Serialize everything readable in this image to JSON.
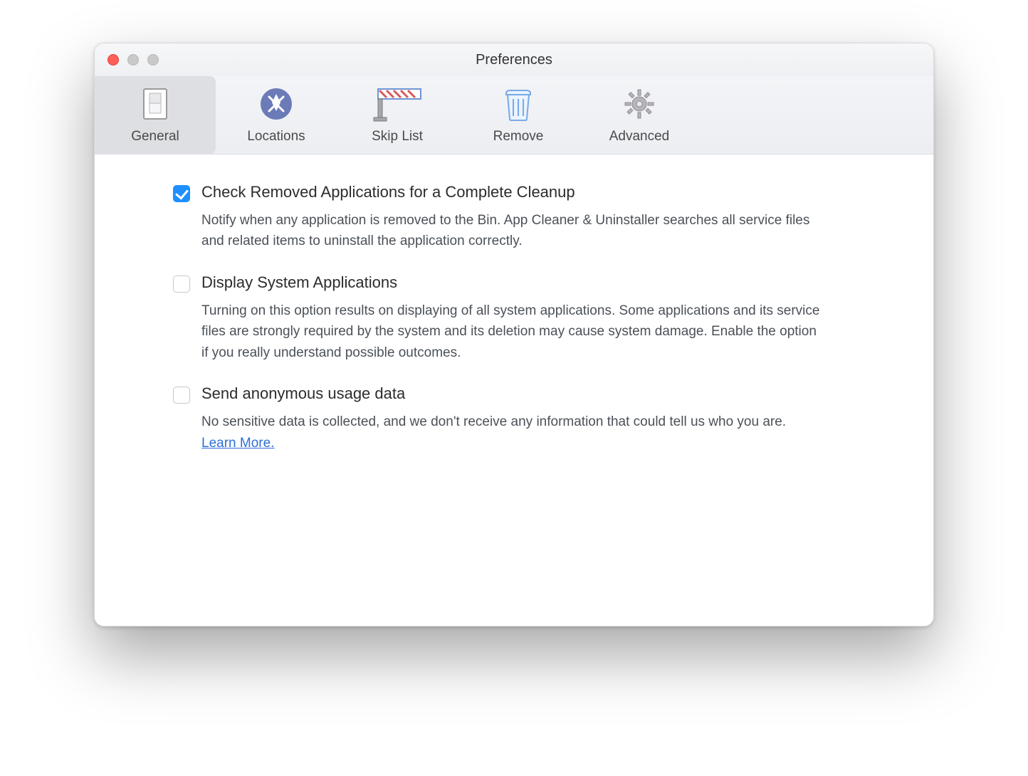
{
  "window": {
    "title": "Preferences"
  },
  "tabs": [
    {
      "label": "General",
      "selected": true
    },
    {
      "label": "Locations",
      "selected": false
    },
    {
      "label": "Skip List",
      "selected": false
    },
    {
      "label": "Remove",
      "selected": false
    },
    {
      "label": "Advanced",
      "selected": false
    }
  ],
  "options": [
    {
      "checked": true,
      "title": "Check Removed Applications for a Complete Cleanup",
      "desc": "Notify when any application is removed to the Bin. App Cleaner & Uninstaller searches all service files and related items to uninstall the application correctly."
    },
    {
      "checked": false,
      "title": "Display System Applications",
      "desc": "Turning on this option results on displaying of all system applications. Some applications and its service files are strongly required by the system and its deletion may cause system damage. Enable the option if you really understand possible outcomes."
    },
    {
      "checked": false,
      "title": "Send anonymous usage data",
      "desc": "No sensitive data is collected, and we don't receive any information that could tell us who you are.   ",
      "link": "Learn More."
    }
  ]
}
